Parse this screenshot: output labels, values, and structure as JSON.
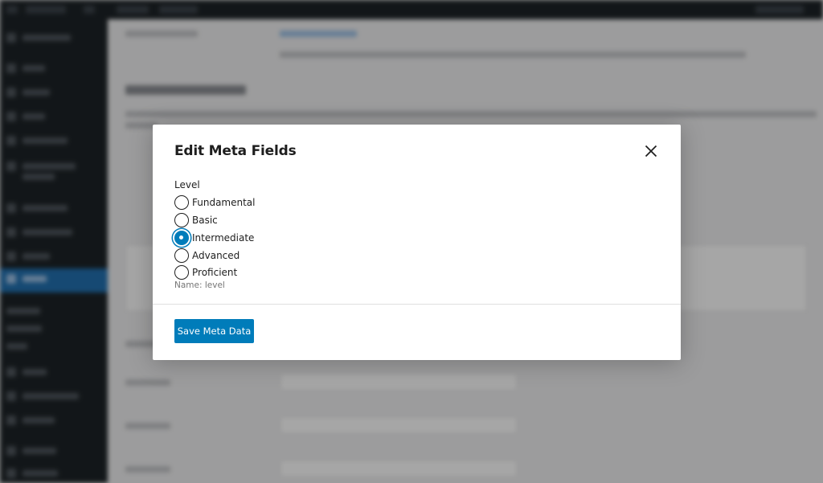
{
  "modal": {
    "title": "Edit Meta Fields",
    "close_icon": "close-icon",
    "field": {
      "label": "Level",
      "options": [
        {
          "label": "Fundamental",
          "checked": false
        },
        {
          "label": "Basic",
          "checked": false
        },
        {
          "label": "Intermediate",
          "checked": true
        },
        {
          "label": "Advanced",
          "checked": false
        },
        {
          "label": "Proficient",
          "checked": false
        }
      ],
      "help_text": "Name: level"
    },
    "save_label": "Save Meta Data"
  },
  "colors": {
    "accent": "#007cba",
    "sidebar": "#1d2327",
    "sidebar_active": "#2271b1"
  }
}
